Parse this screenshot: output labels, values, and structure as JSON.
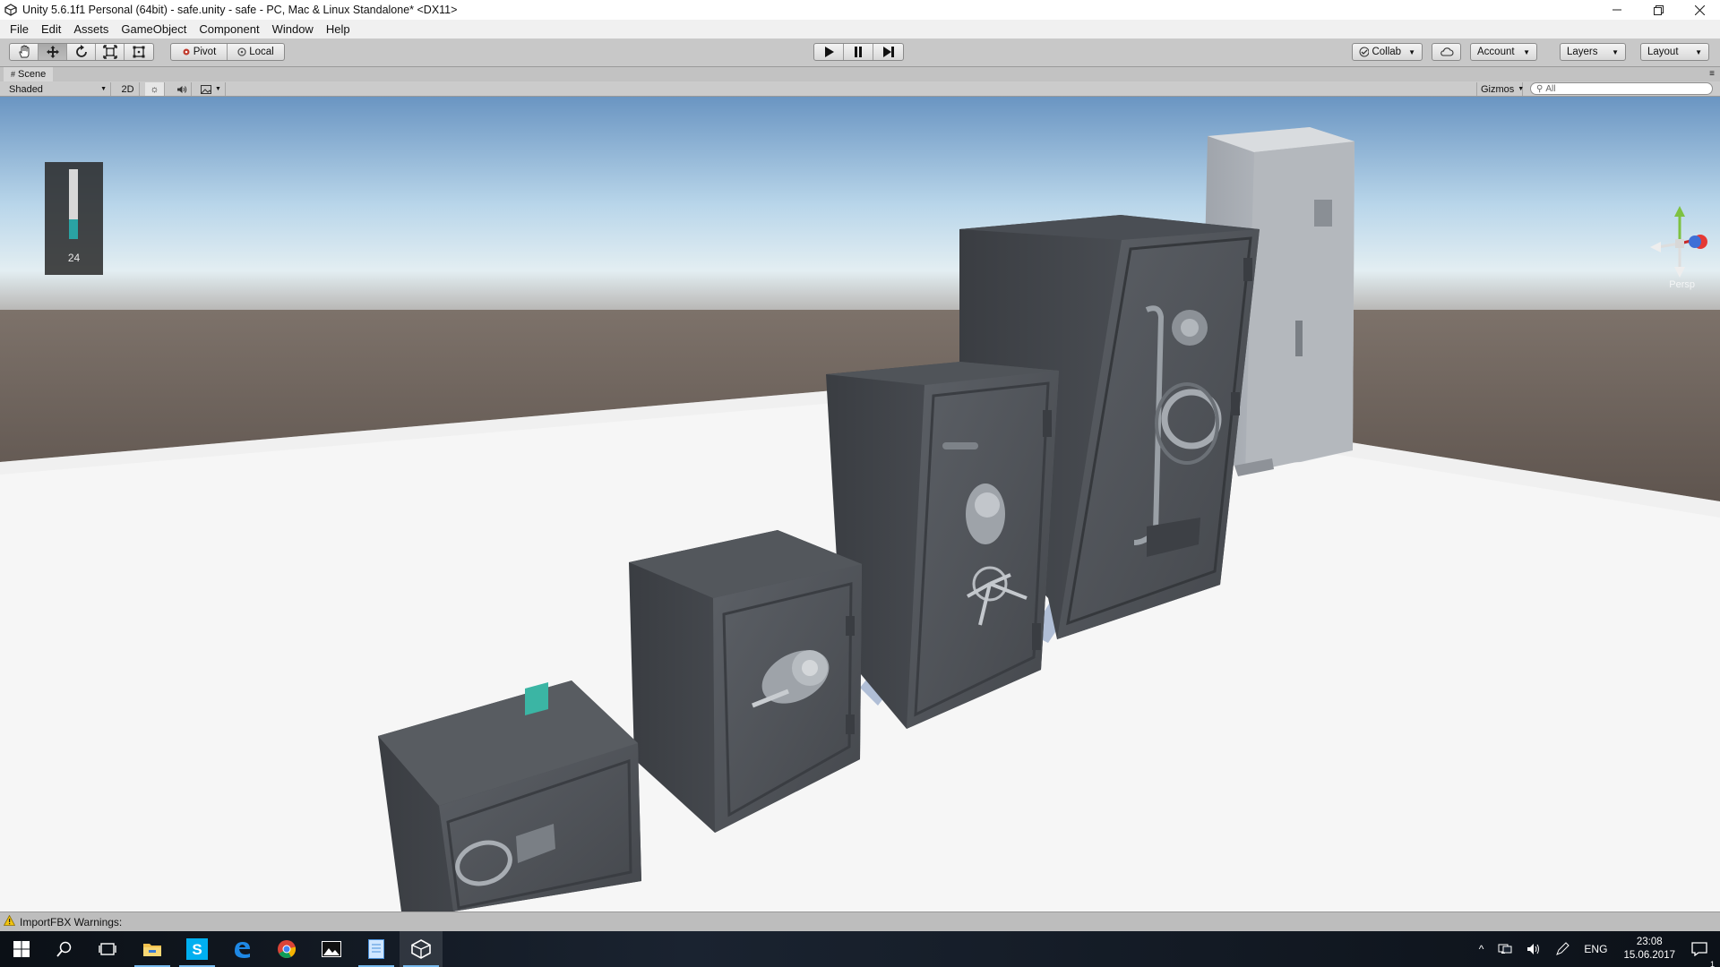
{
  "window": {
    "title": "Unity 5.6.1f1 Personal (64bit) - safe.unity - safe - PC, Mac & Linux Standalone* <DX11>",
    "controls": [
      "minimize",
      "restore",
      "close"
    ]
  },
  "menu": {
    "items": [
      "File",
      "Edit",
      "Assets",
      "GameObject",
      "Component",
      "Window",
      "Help"
    ]
  },
  "toolbar": {
    "tools": [
      {
        "name": "hand-tool",
        "icon": "hand-icon"
      },
      {
        "name": "move-tool",
        "icon": "move-icon",
        "active": true
      },
      {
        "name": "rotate-tool",
        "icon": "rotate-icon"
      },
      {
        "name": "scale-tool",
        "icon": "scale-icon"
      },
      {
        "name": "rect-tool",
        "icon": "rect-icon"
      }
    ],
    "pivot_label": "Pivot",
    "local_label": "Local",
    "play": [
      "play-icon",
      "pause-icon",
      "step-icon"
    ],
    "collab_label": "Collab",
    "account_label": "Account",
    "layers_label": "Layers",
    "layout_label": "Layout"
  },
  "scene": {
    "tab_label": "Scene",
    "shading_label": "Shaded",
    "mode_2d": "2D",
    "gizmos_label": "Gizmos",
    "search_placeholder": "All",
    "meter_value": "24",
    "meter_level": 0.28,
    "projection_label": "Persp"
  },
  "status": {
    "message": "ImportFBX Warnings:"
  },
  "taskbar": {
    "apps": [
      "start-icon",
      "search-icon",
      "task-view-icon",
      "file-explorer-icon",
      "skype-icon",
      "edge-icon",
      "chrome-icon",
      "photos-icon",
      "notepad-icon",
      "unity-icon"
    ],
    "language": "ENG",
    "time": "23:08",
    "date": "15.06.2017",
    "notification_count": "1",
    "colors": {
      "accent": "#76b9ed",
      "skype": "#00aff0",
      "edge": "#1e88e5"
    }
  }
}
